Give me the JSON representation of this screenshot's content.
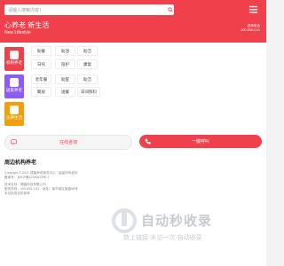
{
  "header": {
    "search_placeholder": "请输入搜索内容！",
    "brand_title": "心养老 新生活",
    "brand_subtitle": "New Lifestyle",
    "contact_label": "咨询电话",
    "contact_phone": "400-838-1111"
  },
  "categories": [
    {
      "label": "机构养老",
      "color": "#f0404b"
    },
    {
      "label": "居家养老",
      "color": "#8b5cf6"
    },
    {
      "label": "乐养生活",
      "color": "#f59e0b"
    }
  ],
  "services": [
    [
      "助餐",
      "助浴",
      "助洁"
    ],
    [
      "日托",
      "陪护",
      "康复"
    ],
    [
      "老年餐",
      "助医",
      "助洁"
    ],
    [
      "聚居",
      "送餐",
      "日间照料"
    ]
  ],
  "actions": {
    "online_label": "在线咨询",
    "call_label": "一键呼叫"
  },
  "footer": {
    "title": "周边机构养老",
    "lines": [
      "Copyright © 2021 德馨养老服务中心 · 保留所有权利",
      "备案号：京ICP备12345678号-1",
      "技术支持：德馨科技有限公司",
      "服务热线：400-838-1111 · 地址：某市某区某路88号",
      "本站信息仅供参考"
    ]
  },
  "watermark": {
    "big": "自动秒收录",
    "small": "数上链接·未访一次·自动收录"
  }
}
